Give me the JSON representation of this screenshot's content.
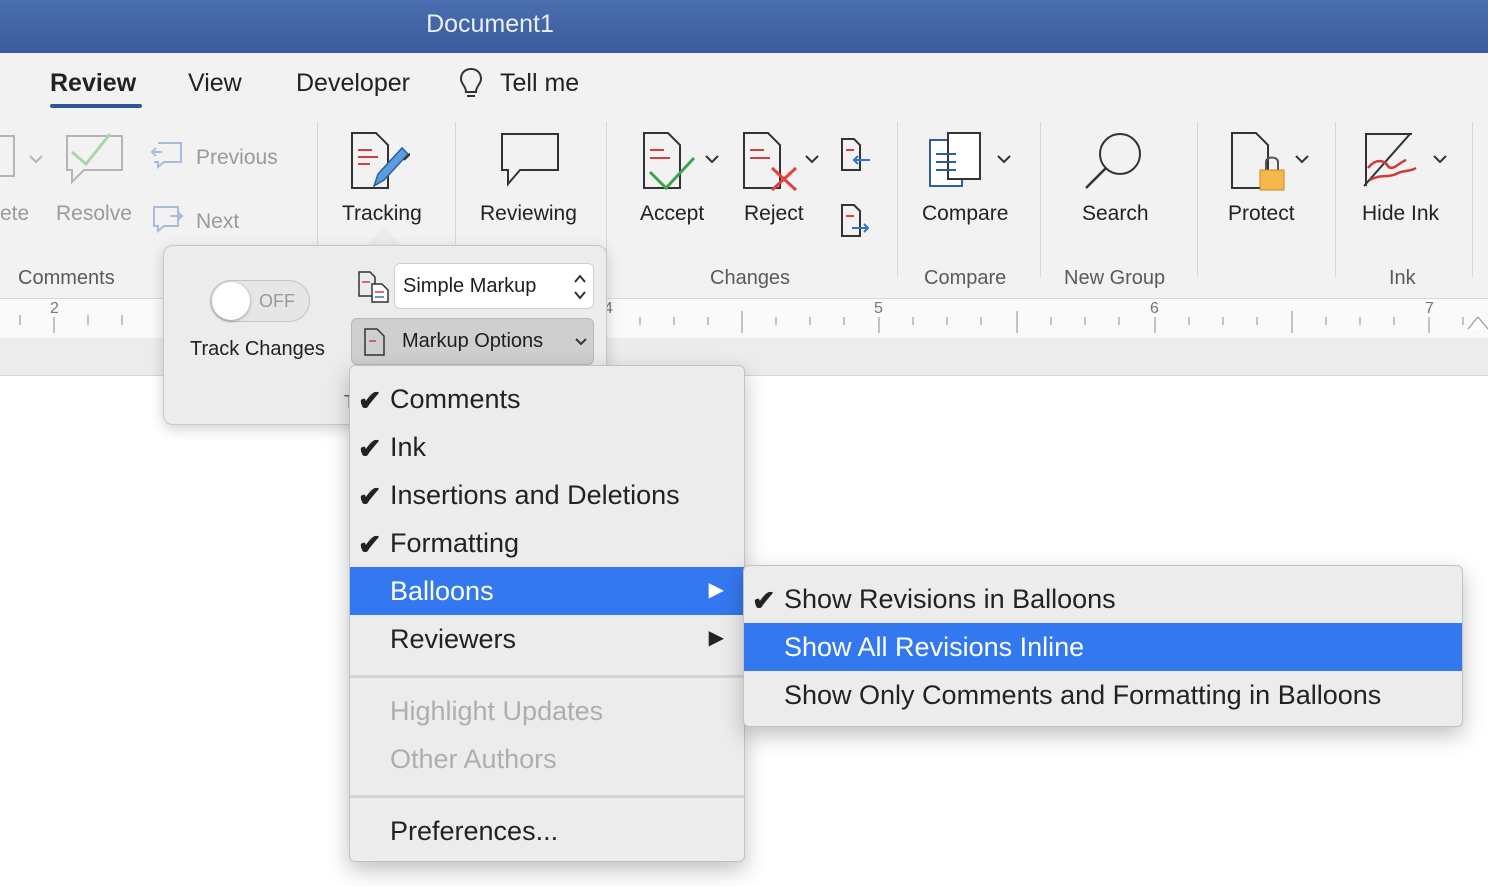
{
  "window": {
    "title": "Document1"
  },
  "tabs": [
    {
      "label": "Review",
      "active": true
    },
    {
      "label": "View",
      "active": false
    },
    {
      "label": "Developer",
      "active": false
    },
    {
      "label": "Tell me",
      "active": false
    }
  ],
  "ribbon": {
    "comments": {
      "delete_fragment": "ete",
      "resolve": "Resolve",
      "previous": "Previous",
      "next": "Next",
      "group": "Comments"
    },
    "tracking": "Tracking",
    "reviewing": "Reviewing",
    "changes": {
      "accept": "Accept",
      "reject": "Reject",
      "group": "Changes"
    },
    "compare": {
      "button": "Compare",
      "group": "Compare"
    },
    "search": {
      "button": "Search",
      "group": "New Group"
    },
    "protect": "Protect",
    "ink": {
      "button": "Hide Ink",
      "group": "Ink"
    }
  },
  "ruler": {
    "numbers": [
      "2",
      "4",
      "5",
      "6",
      "7"
    ]
  },
  "tracking_popover": {
    "toggle_state": "OFF",
    "track_changes_label": "Track Changes",
    "display_for_review": "Simple Markup",
    "markup_options": "Markup Options",
    "partial_letter": "T"
  },
  "markup_menu": {
    "items": [
      {
        "label": "Comments",
        "checked": true
      },
      {
        "label": "Ink",
        "checked": true
      },
      {
        "label": "Insertions and Deletions",
        "checked": true
      },
      {
        "label": "Formatting",
        "checked": true
      },
      {
        "label": "Balloons",
        "submenu": true,
        "highlighted": true
      },
      {
        "label": "Reviewers",
        "submenu": true
      },
      {
        "label": "Highlight Updates",
        "disabled": true
      },
      {
        "label": "Other Authors",
        "disabled": true
      },
      {
        "label": "Preferences..."
      }
    ]
  },
  "balloons_menu": {
    "items": [
      {
        "label": "Show Revisions in Balloons",
        "checked": true
      },
      {
        "label": "Show All Revisions Inline",
        "highlighted": true
      },
      {
        "label": "Show Only Comments and Formatting in Balloons"
      }
    ]
  },
  "colors": {
    "title_bar": "#3f63a6",
    "accent_blue": "#3478f0",
    "ribbon_bg": "#f2f2f2",
    "tab_underline": "#2b579a"
  },
  "icons": [
    "lightbulb-icon",
    "resolve-comment-icon",
    "previous-comment-icon",
    "next-comment-icon",
    "tracking-icon",
    "reviewing-icon",
    "accept-icon",
    "reject-icon",
    "previous-change-icon",
    "next-change-icon",
    "compare-icon",
    "search-icon",
    "protect-icon",
    "hide-ink-icon",
    "chevron-down-icon",
    "checkmark-icon",
    "submenu-arrow-icon"
  ]
}
